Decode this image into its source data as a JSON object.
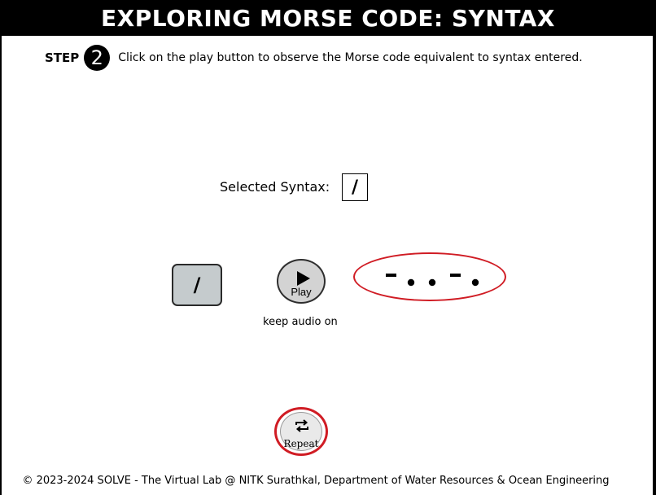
{
  "header": {
    "title": "EXPLORING MORSE CODE: SYNTAX"
  },
  "step": {
    "label": "STEP",
    "number": "2",
    "instruction": "Click on the play button to observe the Morse code equivalent to syntax entered."
  },
  "selection": {
    "label": "Selected Syntax:",
    "value": "/"
  },
  "keypad": {
    "key_label": "/"
  },
  "player": {
    "play_label": "Play",
    "audio_note": "keep audio on",
    "play_icon": "play-triangle-icon"
  },
  "morse": {
    "code": "-..-.",
    "highlight_color": "#d01c24"
  },
  "repeat": {
    "label": "Repeat",
    "icon": "repeat-arrows-icon"
  },
  "footer": {
    "text": "© 2023-2024 SOLVE - The Virtual Lab @ NITK Surathkal, Department of Water Resources & Ocean Engineering"
  }
}
